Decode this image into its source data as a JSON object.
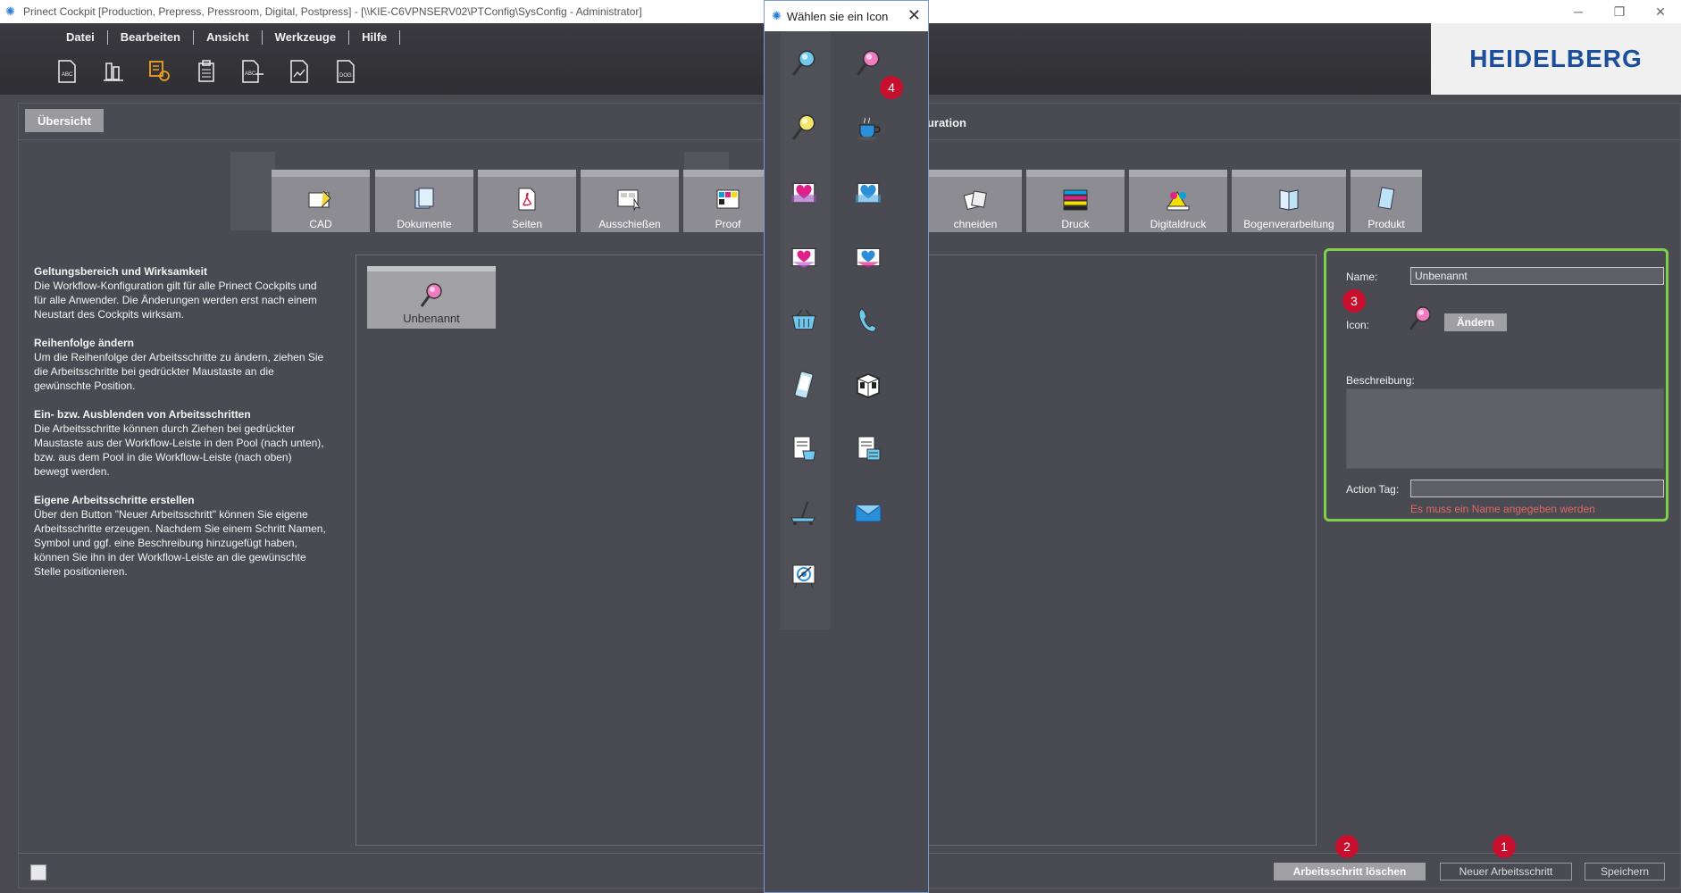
{
  "window": {
    "title": "Prinect Cockpit [Production, Prepress, Pressroom, Digital, Postpress] - [\\\\KIE-C6VPNSERV02\\PTConfig\\SysConfig - Administrator]",
    "minimize": "─",
    "restore": "❐",
    "close": "✕"
  },
  "menu": [
    {
      "label": "Datei"
    },
    {
      "label": "Bearbeiten"
    },
    {
      "label": "Ansicht"
    },
    {
      "label": "Werkzeuge"
    },
    {
      "label": "Hilfe"
    }
  ],
  "toolbar": [
    {
      "icon": "document-abc-icon"
    },
    {
      "icon": "chart-doc-icon"
    },
    {
      "icon": "workflow-config-icon",
      "active": true
    },
    {
      "icon": "clipboard-list-icon"
    },
    {
      "icon": "document-abc-arrow-icon"
    },
    {
      "icon": "document-chart-icon"
    },
    {
      "icon": "document-dog-icon"
    }
  ],
  "logo": {
    "text": "HEIDELBERG"
  },
  "tabs": {
    "overview": "Übersicht",
    "config_title": "guration"
  },
  "workflow": [
    {
      "label": "CAD"
    },
    {
      "label": "Dokumente"
    },
    {
      "label": "Seiten"
    },
    {
      "label": "Ausschießen"
    },
    {
      "label": "Proof"
    },
    {
      "label": "chneiden"
    },
    {
      "label": "Druck"
    },
    {
      "label": "Digitaldruck"
    },
    {
      "label": "Bogenverarbeitung"
    },
    {
      "label": "Produkt"
    }
  ],
  "help": [
    {
      "heading": "Geltungsbereich und Wirksamkeit",
      "text": "Die Workflow-Konfiguration gilt für alle Prinect Cockpits und für alle Anwender. Die Änderungen werden erst nach einem Neustart des Cockpits wirksam."
    },
    {
      "heading": "Reihenfolge ändern",
      "text": "Um die Reihenfolge der Arbeitsschritte zu ändern, ziehen Sie die Arbeitsschritte bei gedrückter Maustaste an die gewünschte Position."
    },
    {
      "heading": "Ein- bzw. Ausblenden von Arbeitsschritten",
      "text": "Die Arbeitsschritte können durch Ziehen bei gedrückter Maustaste aus der Workflow-Leiste in den Pool (nach unten), bzw. aus dem Pool in die Workflow-Leiste (nach oben) bewegt werden."
    },
    {
      "heading": "Eigene Arbeitsschritte erstellen",
      "text": "Über den Button \"Neuer Arbeitsschritt\" können Sie eigene Arbeitsschritte erzeugen. Nachdem Sie einem Schritt Namen, Symbol und ggf. eine Beschreibung hinzugefügt haben, können Sie ihn in der Workflow-Leiste an die gewünschte Stelle positionieren."
    }
  ],
  "pool": {
    "items": [
      {
        "label": "Unbenannt",
        "icon": "pink-magnifier-icon"
      }
    ]
  },
  "details": {
    "name_label": "Name:",
    "name_value": "Unbenannt",
    "icon_label": "Icon:",
    "change_button": "Ändern",
    "description_label": "Beschreibung:",
    "action_tag_label": "Action Tag:",
    "action_tag_value": "",
    "error": "Es muss ein Name angegeben werden"
  },
  "bottom": {
    "delete_button": "Arbeitsschritt löschen",
    "new_button": "Neuer Arbeitsschritt",
    "save_button": "Speichern"
  },
  "badges": [
    "1",
    "2",
    "3",
    "4"
  ],
  "dialog": {
    "title": "Wählen sie ein Icon",
    "icons": [
      "blue-magnifier-icon",
      "pink-magnifier-icon",
      "yellow-magnifier-icon",
      "coffee-cup-icon",
      "pink-heart-folder-icon",
      "blue-heart-folder-icon",
      "pink-heart-tray-icon",
      "blue-heart-tray-icon",
      "shopping-basket-icon",
      "telephone-icon",
      "mobile-phone-icon",
      "package-box-icon",
      "invoice-basket-icon",
      "invoice-document-icon",
      "pallet-truck-icon",
      "envelope-icon",
      "target-easel-icon"
    ]
  },
  "colors": {
    "accent_green": "#7ed04c",
    "badge_red": "#c8102e",
    "brand_blue": "#1b4e9b"
  }
}
